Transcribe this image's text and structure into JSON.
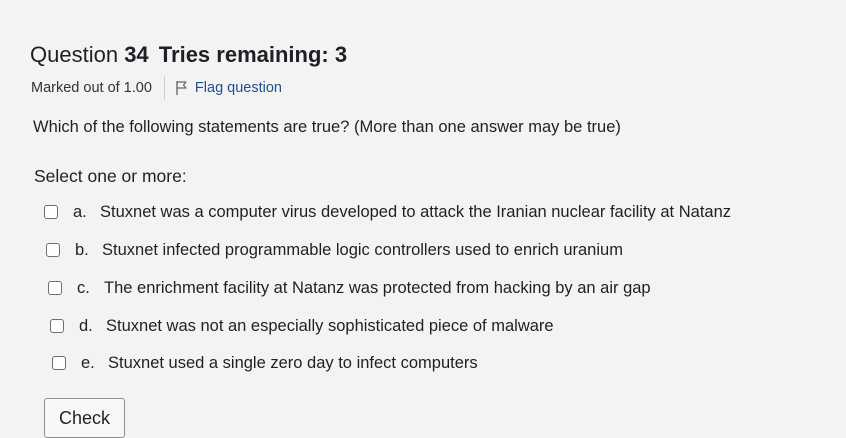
{
  "question": {
    "word": "Question",
    "number": "34",
    "tries": "Tries remaining: 3",
    "marks": "Marked out of 1.00",
    "flag_label": "Flag question",
    "text": "Which of the following statements are true? (More than one answer may be true)",
    "prompt": "Select one or more:"
  },
  "answers": [
    {
      "letter": "a.",
      "text": "Stuxnet was a computer virus developed to attack the Iranian nuclear facility at Natanz",
      "checked": false
    },
    {
      "letter": "b.",
      "text": "Stuxnet infected programmable logic controllers used to enrich uranium",
      "checked": false
    },
    {
      "letter": "c.",
      "text": "The enrichment facility at Natanz was protected from hacking by an air gap",
      "checked": false
    },
    {
      "letter": "d.",
      "text": "Stuxnet was not an especially sophisticated piece of malware",
      "checked": false
    },
    {
      "letter": "e.",
      "text": "Stuxnet used a single zero day to infect computers",
      "checked": false
    }
  ],
  "actions": {
    "check_label": "Check"
  },
  "icons": {
    "flag": "flag-icon"
  },
  "colors": {
    "background": "#f3f3f3",
    "link": "#1f4f8f",
    "text": "#1d2125"
  }
}
